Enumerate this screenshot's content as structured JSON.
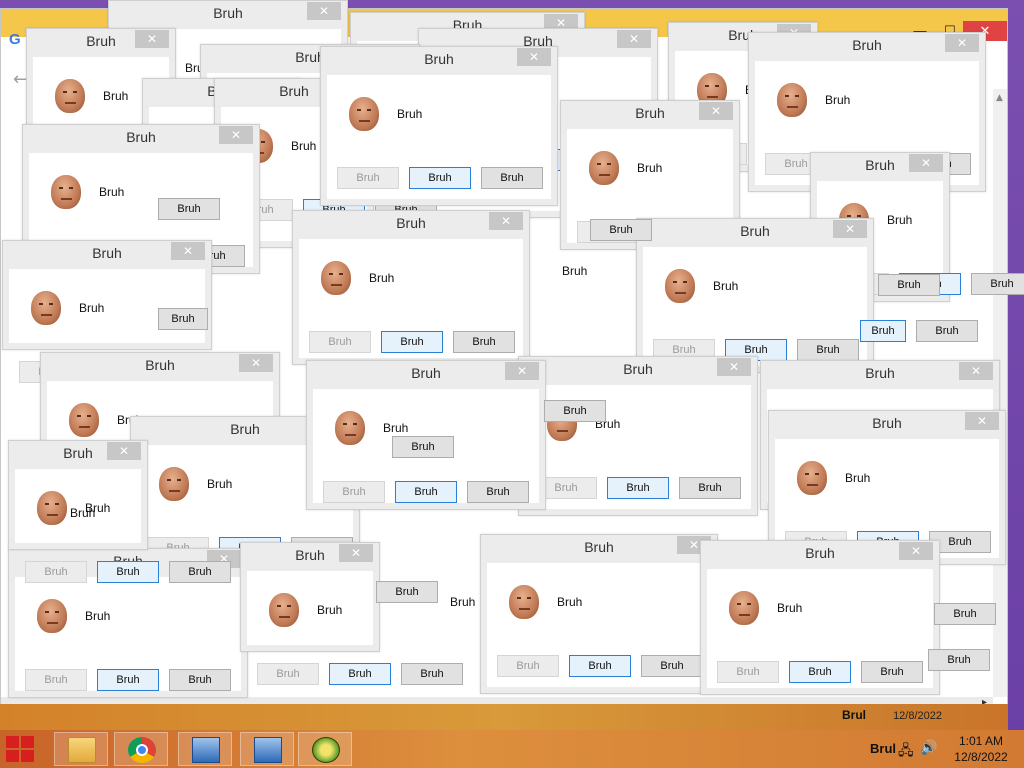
{
  "dialog": {
    "title": "Bruh",
    "message": "Bruh",
    "button_left": "Bruh",
    "button_middle": "Bruh",
    "button_right": "Bruh",
    "close_glyph": "✕"
  },
  "browser": {
    "logo": "G",
    "back_glyph": "←",
    "minimize_glyph": "—",
    "maximize_glyph": "☐",
    "close_glyph": "✕",
    "scroll_up": "▲",
    "scroll_right": "▸"
  },
  "taskbar": {
    "tray_label": "Brul",
    "network_icon": "network-icon",
    "volume_icon": "speaker-icon",
    "time": "1:01 AM",
    "date": "12/8/2022",
    "ghost_date": "12/8/2022",
    "ghost_label": "Brul",
    "apps": [
      "file-explorer",
      "chrome",
      "network-computers",
      "network-computers",
      "app-shield"
    ]
  },
  "colors": {
    "wallpaper": "#7a4fb0",
    "taskbar": "#d27a33",
    "dialog_frame": "#ececec",
    "default_button_border": "#2a7fd6",
    "close_button": "#c7c7c7",
    "browser_tabstrip": "#f4c64a"
  }
}
